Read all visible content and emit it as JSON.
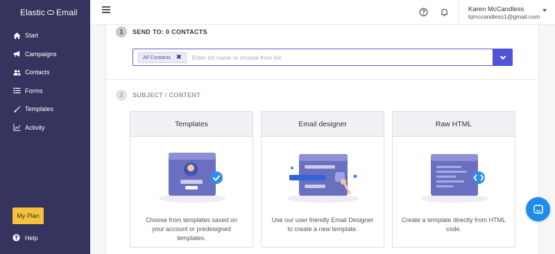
{
  "app": {
    "logo_left": "Elastic",
    "logo_right": "Email"
  },
  "sidebar": {
    "items": [
      {
        "label": "Start",
        "icon": "home-icon"
      },
      {
        "label": "Campaigns",
        "icon": "bullhorn-icon"
      },
      {
        "label": "Contacts",
        "icon": "users-icon"
      },
      {
        "label": "Forms",
        "icon": "list-icon"
      },
      {
        "label": "Templates",
        "icon": "brush-icon"
      },
      {
        "label": "Activity",
        "icon": "chart-line-icon"
      }
    ],
    "my_plan": "My Plan",
    "help": "Help"
  },
  "topbar": {
    "user_name": "Karen McCandless",
    "user_email": "kjmccandless1@gmail.com"
  },
  "step1": {
    "number": "1",
    "title": "SEND TO: 0 CONTACTS",
    "tag": "All Contacts",
    "placeholder": "Enter list name or choose from list"
  },
  "step2": {
    "number": "2",
    "title": "SUBJECT / CONTENT"
  },
  "cards": [
    {
      "title": "Templates",
      "description": "Choose from templates saved on your account or predesigned templates."
    },
    {
      "title": "Email designer",
      "description": "Use our user friendly Email Designer to create a new template."
    },
    {
      "title": "Raw HTML",
      "description": "Create a template directly from HTML code."
    }
  ],
  "colors": {
    "sidebar": "#35345e",
    "accent": "#4f54d6",
    "plan_button": "#f6c23e",
    "chat": "#1f8ceb"
  }
}
